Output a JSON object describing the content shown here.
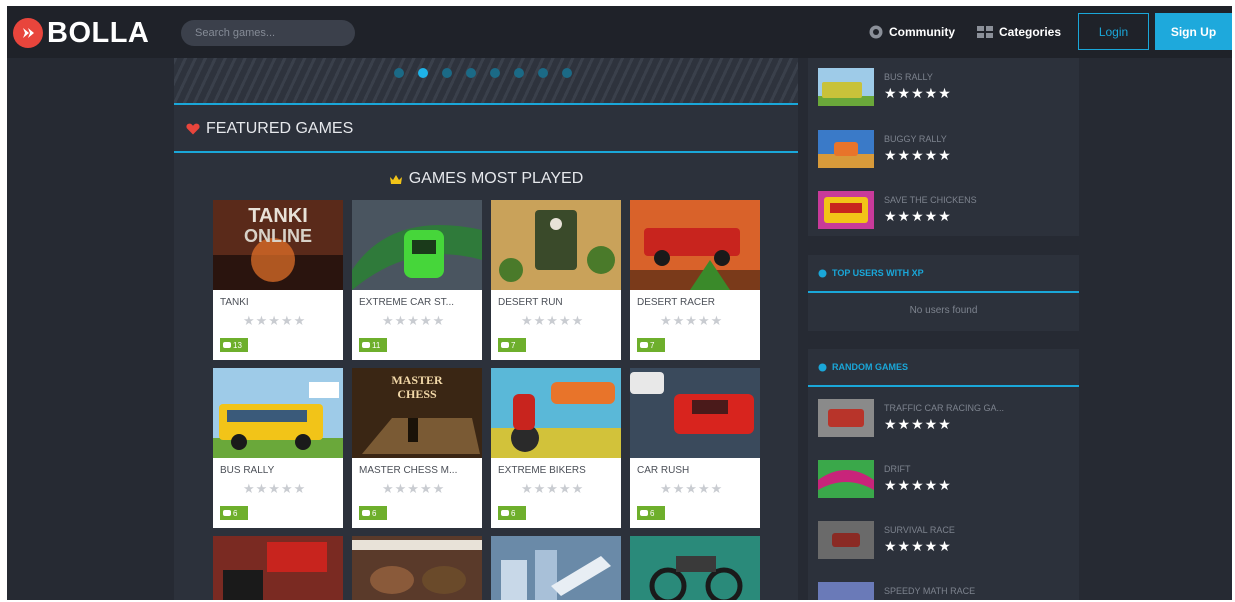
{
  "header": {
    "logo_text": "BOLLA",
    "search_placeholder": "Search games...",
    "community_label": "Community",
    "categories_label": "Categories",
    "login_label": "Login",
    "signup_label": "Sign Up"
  },
  "banner": {
    "slide_count": 8,
    "active_slide": 2
  },
  "featured": {
    "title": "FEATURED GAMES"
  },
  "most_played": {
    "title": "GAMES MOST PLAYED",
    "games": [
      {
        "title": "TANKI",
        "plays": "13",
        "stars": "★★★★★",
        "thumb_color": "#5a2a1a"
      },
      {
        "title": "EXTREME CAR ST...",
        "plays": "11",
        "stars": "★★★★★",
        "thumb_color": "#2f7a3a"
      },
      {
        "title": "DESERT RUN",
        "plays": "7",
        "stars": "★★★★★",
        "thumb_color": "#c9a25a"
      },
      {
        "title": "DESERT RACER",
        "plays": "7",
        "stars": "★★★★★",
        "thumb_color": "#d9622a"
      },
      {
        "title": "BUS RALLY",
        "plays": "6",
        "stars": "★★★★★",
        "thumb_color": "#7ab2d8"
      },
      {
        "title": "MASTER CHESS M...",
        "plays": "6",
        "stars": "★★★★★",
        "thumb_color": "#3a2614"
      },
      {
        "title": "EXTREME BIKERS",
        "plays": "6",
        "stars": "★★★★★",
        "thumb_color": "#d2c23a"
      },
      {
        "title": "CAR RUSH",
        "plays": "6",
        "stars": "★★★★★",
        "thumb_color": "#3a4a5c"
      }
    ],
    "row3_colors": [
      "#7a2a22",
      "#5a3a2a",
      "#6a8aa8",
      "#2a8a7a"
    ]
  },
  "sidebar": {
    "top_games": [
      {
        "name": "BUS RALLY",
        "stars": "★★★★★",
        "thumb_color": "#c8c23a"
      },
      {
        "name": "BUGGY RALLY",
        "stars": "★★★★★",
        "thumb_color": "#3a7ac8"
      },
      {
        "name": "SAVE THE CHICKENS",
        "stars": "★★★★★",
        "thumb_color": "#c83a9a"
      }
    ],
    "top_users": {
      "title": "TOP USERS WITH XP",
      "empty_text": "No users found"
    },
    "random_games": {
      "title": "RANDOM GAMES",
      "items": [
        {
          "name": "TRAFFIC CAR RACING GA...",
          "stars": "★★★★★",
          "thumb_color": "#b8342a"
        },
        {
          "name": "DRIFT",
          "stars": "★★★★★",
          "thumb_color": "#3aa84a"
        },
        {
          "name": "SURVIVAL RACE",
          "stars": "★★★★★",
          "thumb_color": "#8a2a24"
        },
        {
          "name": "SPEEDY MATH RACE",
          "stars": "",
          "thumb_color": "#6a7ab8"
        }
      ]
    }
  },
  "colors": {
    "accent": "#1aa7d9",
    "heart": "#e8453c",
    "crown": "#f2c418",
    "badge_green": "#6eaf2c"
  }
}
